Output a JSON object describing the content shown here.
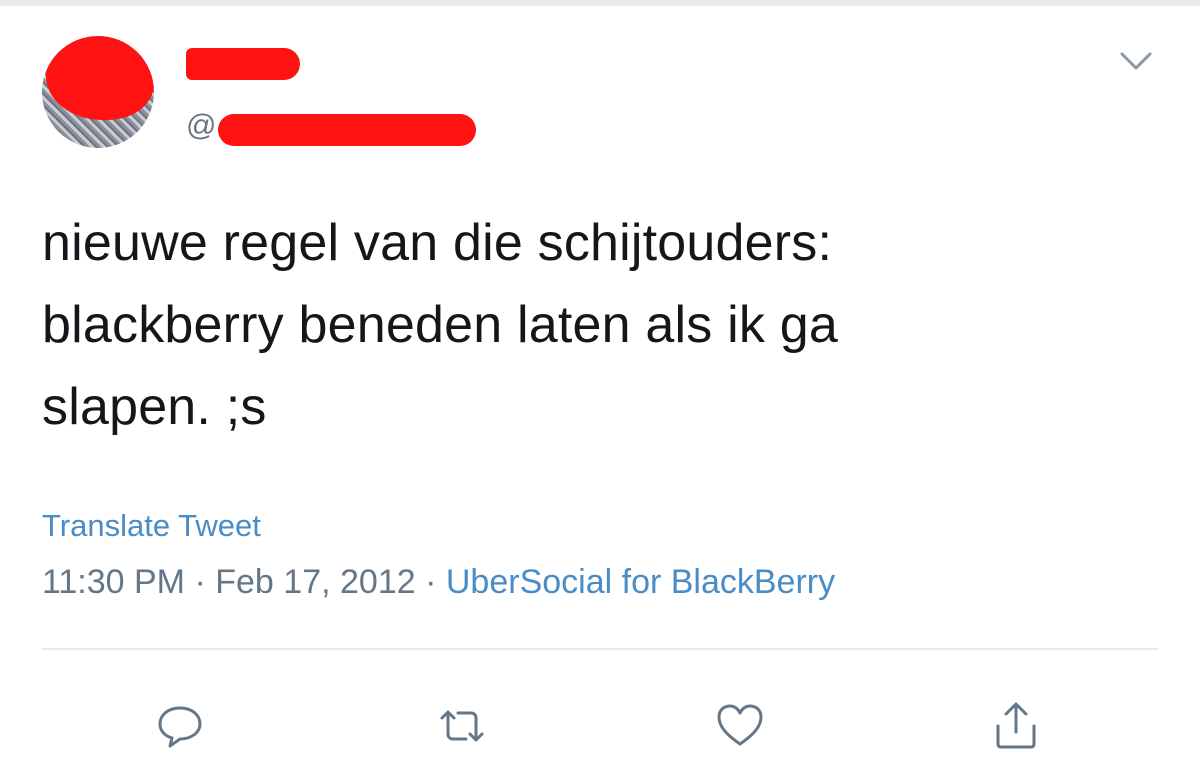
{
  "tweet": {
    "handle_prefix": "@",
    "text_lines": [
      "nieuwe regel van die schijtouders:",
      "blackberry beneden laten als ik ga",
      "slapen. ;s"
    ],
    "translate_label": "Translate Tweet",
    "time": "11:30 PM",
    "separator": "·",
    "date": "Feb 17, 2012",
    "source": "UberSocial for BlackBerry"
  },
  "icons": {
    "caret": "chevron-down-icon",
    "reply": "reply-icon",
    "retweet": "retweet-icon",
    "like": "heart-icon",
    "share": "share-icon"
  },
  "colors": {
    "redaction": "#ff1212",
    "link_blue": "#4a8cc6",
    "secondary_gray": "#657786",
    "text_dark": "#14171a"
  }
}
